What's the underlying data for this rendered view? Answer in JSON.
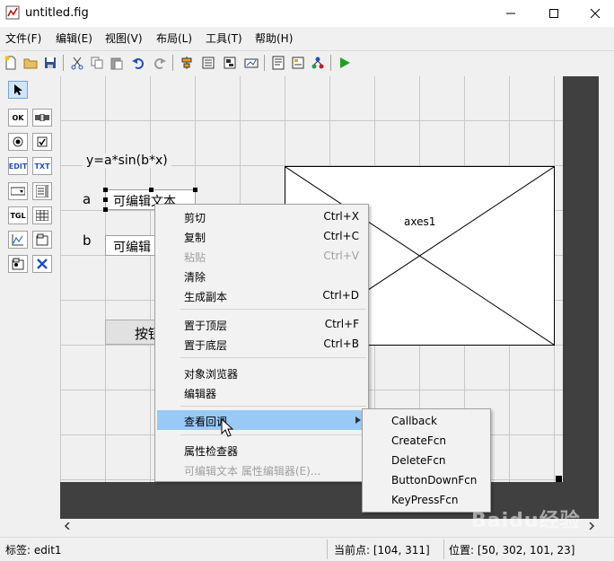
{
  "window": {
    "title": "untitled.fig"
  },
  "menubar": [
    "文件(F)",
    "编辑(E)",
    "视图(V)",
    "布局(L)",
    "工具(T)",
    "帮助(H)"
  ],
  "figure": {
    "static_text": "y=a*sin(b*x)",
    "label_a": "a",
    "label_b": "b",
    "edit1_text": "可编辑文本",
    "edit2_text": "可编辑",
    "button_text": "按钮",
    "axes_label": "axes1"
  },
  "context_menu": {
    "items": [
      {
        "label": "剪切",
        "shortcut": "Ctrl+X"
      },
      {
        "label": "复制",
        "shortcut": "Ctrl+C"
      },
      {
        "label": "粘贴",
        "shortcut": "Ctrl+V"
      },
      {
        "label": "清除",
        "shortcut": ""
      },
      {
        "label": "生成副本",
        "shortcut": "Ctrl+D"
      },
      {
        "label": "置于顶层",
        "shortcut": "Ctrl+F"
      },
      {
        "label": "置于底层",
        "shortcut": "Ctrl+B"
      },
      {
        "label": "对象浏览器",
        "shortcut": ""
      },
      {
        "label": "编辑器",
        "shortcut": ""
      },
      {
        "label": "查看回调",
        "shortcut": ""
      },
      {
        "label": "属性检查器",
        "shortcut": ""
      },
      {
        "label": "可编辑文本 属性编辑器(E)...",
        "shortcut": ""
      }
    ]
  },
  "submenu": {
    "items": [
      "Callback",
      "CreateFcn",
      "DeleteFcn",
      "ButtonDownFcn",
      "KeyPressFcn"
    ]
  },
  "statusbar": {
    "tag": "标签: edit1",
    "current_point": "当前点:  [104, 311]",
    "position": "位置: [50, 302, 101, 23]"
  },
  "watermark": "Baidu经验",
  "colors": {
    "highlight": "#99c9f5",
    "dark_area": "#404040",
    "grid": "#c8c8c8"
  }
}
